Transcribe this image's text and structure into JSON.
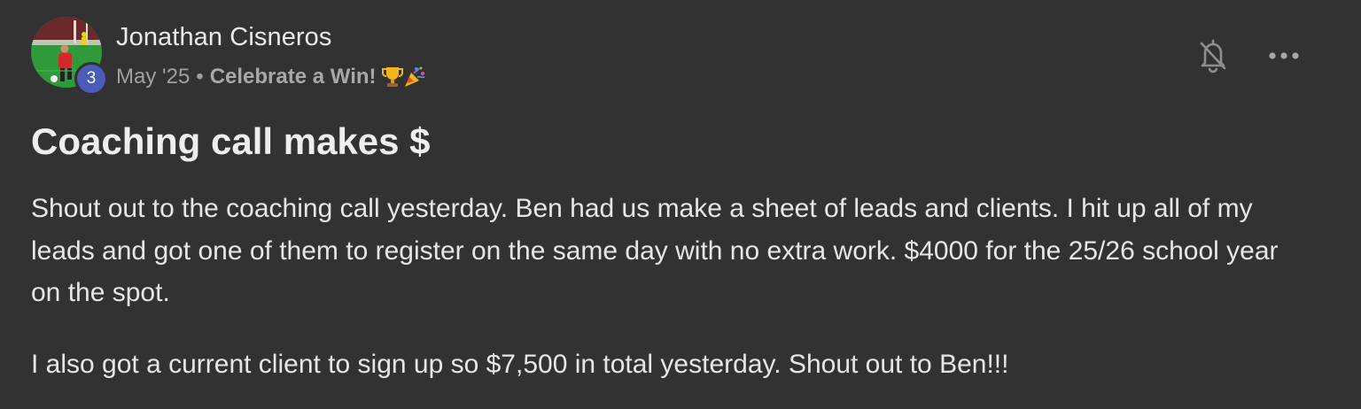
{
  "post": {
    "author": {
      "name": "Jonathan Cisneros",
      "level": "3",
      "avatar": "soccer-player-avatar"
    },
    "meta": {
      "date": "May '25",
      "separator": "•",
      "category": "Celebrate a Win!",
      "category_icons": [
        "trophy-icon",
        "party-popper-icon"
      ]
    },
    "actions": {
      "notifications": "bell-off-icon",
      "more": "more-options-icon"
    },
    "title": "Coaching call makes $",
    "paragraphs": [
      "Shout out to the coaching call yesterday. Ben had us make a sheet of leads and clients. I hit up all of my leads and got one of them to register on the same day with no extra work. $4000 for the 25/26 school year on the spot.",
      "I also got a current client to sign up so $7,500 in total yesterday. Shout out to Ben!!!"
    ],
    "colors": {
      "background": "#323232",
      "text": "#e6e6e6",
      "muted": "#a0a0a0",
      "badge": "#4a5bb8"
    }
  }
}
